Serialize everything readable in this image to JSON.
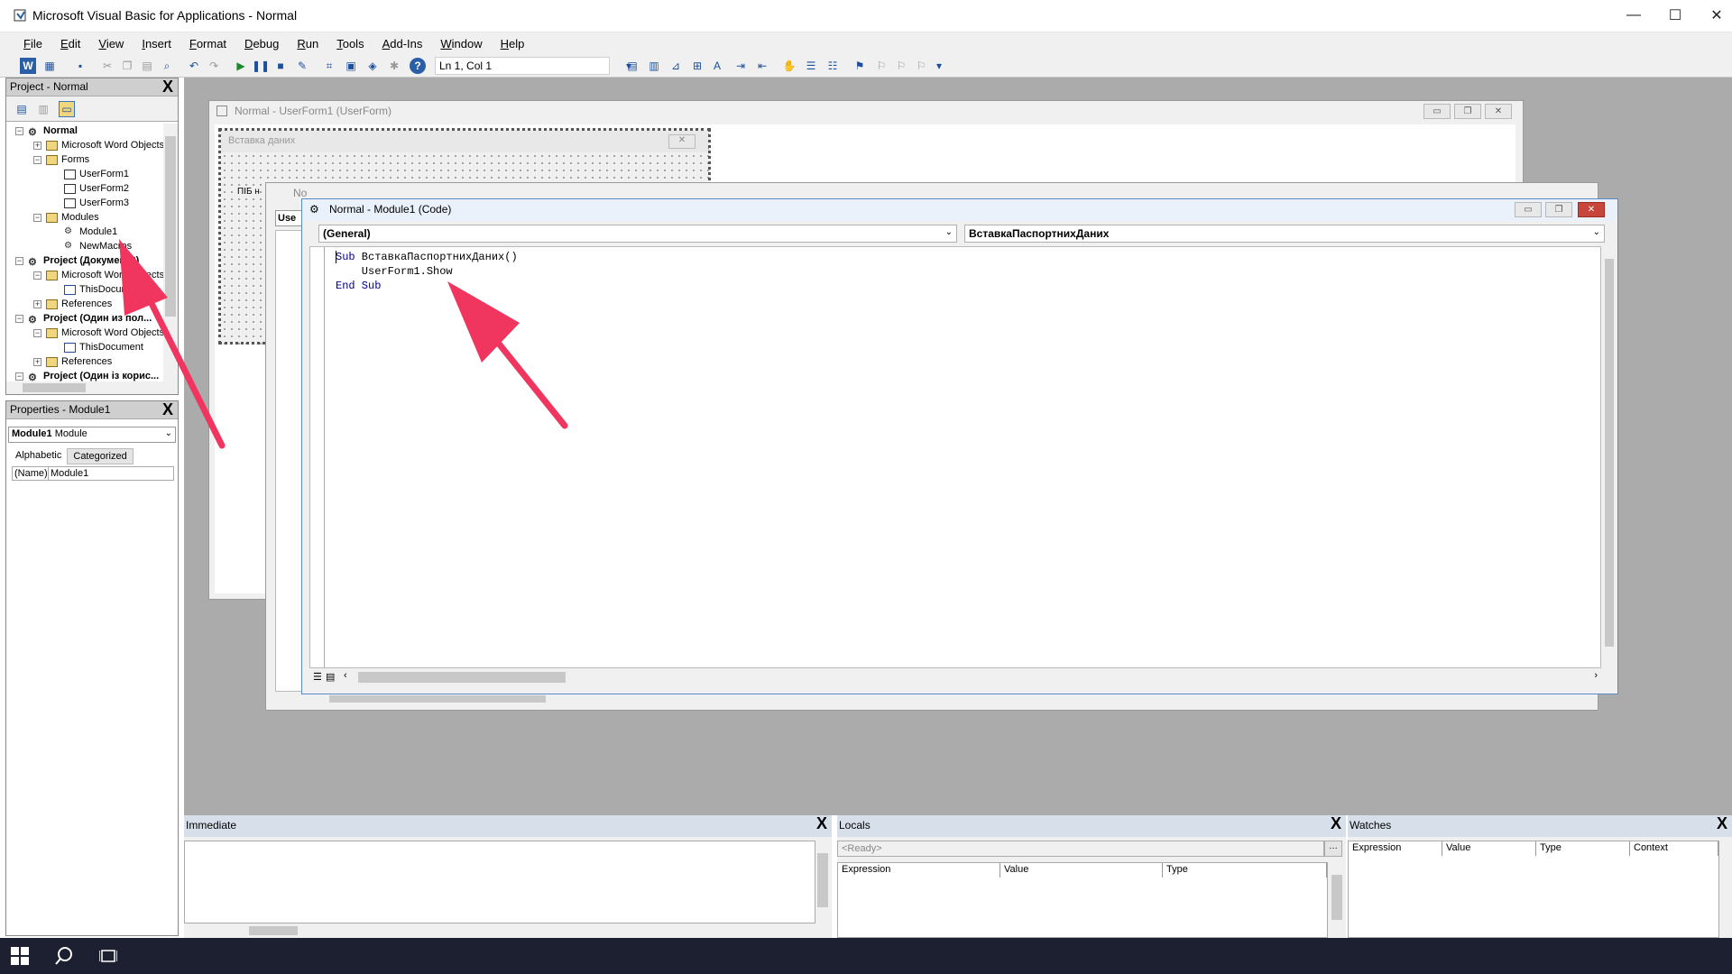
{
  "app": {
    "title": "Microsoft Visual Basic for Applications - Normal",
    "minimize": "—",
    "maximize": "☐",
    "close": "✕"
  },
  "menu": [
    "File",
    "Edit",
    "View",
    "Insert",
    "Format",
    "Debug",
    "Run",
    "Tools",
    "Add-Ins",
    "Window",
    "Help"
  ],
  "toolbar": {
    "position": "Ln 1, Col 1",
    "icons": [
      "word-icon",
      "insert-userform-icon",
      "save-icon",
      "cut-icon",
      "copy-icon",
      "paste-icon",
      "find-icon",
      "undo-icon",
      "redo-icon",
      "run-icon",
      "break-icon",
      "reset-icon",
      "design-mode-icon",
      "project-explorer-icon",
      "properties-icon",
      "object-browser-icon",
      "toolbox-icon",
      "help-icon"
    ]
  },
  "project_pane": {
    "title": "Project - Normal",
    "close": "X",
    "tree": [
      {
        "label": "Normal",
        "type": "proj",
        "bold": true
      },
      {
        "label": "Microsoft Word Objects",
        "type": "folder"
      },
      {
        "label": "Forms",
        "type": "folder"
      },
      {
        "label": "UserForm1",
        "type": "form"
      },
      {
        "label": "UserForm2",
        "type": "form"
      },
      {
        "label": "UserForm3",
        "type": "form"
      },
      {
        "label": "Modules",
        "type": "folder"
      },
      {
        "label": "Module1",
        "type": "mod"
      },
      {
        "label": "NewMacros",
        "type": "mod"
      },
      {
        "label": "Project (Документ2)",
        "type": "proj",
        "bold": true
      },
      {
        "label": "Microsoft Word Objects",
        "type": "folder"
      },
      {
        "label": "ThisDocument",
        "type": "doc"
      },
      {
        "label": "References",
        "type": "folder"
      },
      {
        "label": "Project (Один из пол...",
        "type": "proj",
        "bold": true
      },
      {
        "label": "Microsoft Word Objects",
        "type": "folder"
      },
      {
        "label": "ThisDocument",
        "type": "doc"
      },
      {
        "label": "References",
        "type": "folder"
      },
      {
        "label": "Project (Один із корис...",
        "type": "proj",
        "bold": true
      }
    ]
  },
  "properties_pane": {
    "title": "Properties - Module1",
    "close": "X",
    "object": "Module1",
    "object_type": "Module",
    "tabs": [
      "Alphabetic",
      "Categorized"
    ],
    "name_label": "(Name)",
    "name_value": "Module1"
  },
  "userform_window": {
    "title": "Normal - UserForm1 (UserForm)",
    "form_caption": "Вставка даних",
    "label_fragment": "ПІБ н"
  },
  "mid_window": {
    "title": "No",
    "tab": "Use"
  },
  "code_window": {
    "title": "Normal - Module1 (Code)",
    "object_combo": "(General)",
    "proc_combo": "ВставкаПаспортнихДаних",
    "lines": [
      {
        "kw": "Sub",
        "rest": " ВставкаПаспортнихДаних()"
      },
      {
        "kw": "",
        "rest": "    UserForm1.Show"
      },
      {
        "kw": "End Sub",
        "rest": ""
      }
    ]
  },
  "immediate": {
    "title": "Immediate",
    "close": "X"
  },
  "locals": {
    "title": "Locals",
    "close": "X",
    "status": "<Ready>",
    "columns": [
      "Expression",
      "Value",
      "Type"
    ]
  },
  "watches": {
    "title": "Watches",
    "close": "X",
    "columns": [
      "Expression",
      "Value",
      "Type",
      "Context"
    ]
  },
  "colors": {
    "arrow": "#f0355f",
    "workspace": "#ababab",
    "pane_header": "#d7e0ea",
    "keyword": "#00008b"
  }
}
